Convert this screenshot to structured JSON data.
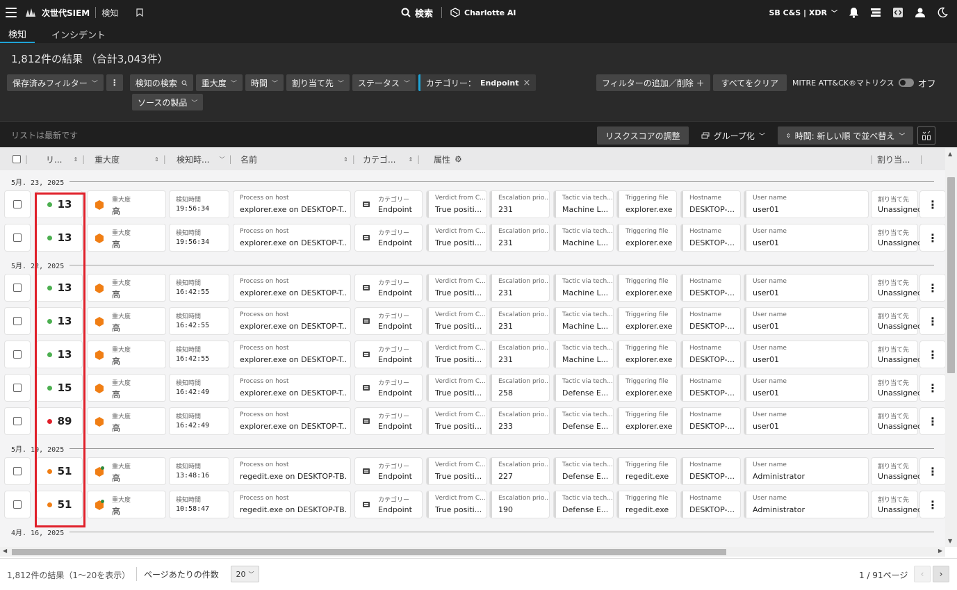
{
  "app": {
    "title": "次世代SIEM",
    "section": "検知",
    "search_label": "検索",
    "charlotte_label": "Charlotte AI",
    "tenant": "SB C&S | XDR"
  },
  "tabs": [
    {
      "label": "検知",
      "active": true
    },
    {
      "label": "インシデント",
      "active": false
    }
  ],
  "header": {
    "results_title": "1,812件の結果 （合計3,043件）",
    "saved_filters": "保存済みフィルター",
    "kebab": "⋮",
    "filters": [
      {
        "label": "検知の検索"
      },
      {
        "label": "重大度"
      },
      {
        "label": "時間"
      },
      {
        "label": "割り当て先"
      },
      {
        "label": "ステータス"
      }
    ],
    "category_filter_label": "カテゴリー：",
    "category_filter_value": "Endpoint",
    "source_product": "ソースの製品",
    "add_remove_filter": "フィルターの追加／削除 ＋",
    "clear_all": "すべてをクリア",
    "mitre_label": "MITRE ATT&CK®マトリクス",
    "mitre_state": "オフ"
  },
  "subbar": {
    "list_status": "リストは最新です",
    "risk_adjust": "リスクスコアの調整",
    "group_by": "グループ化",
    "sort": "時間: 新しい順 で並べ替え"
  },
  "columns": {
    "risk": "リ...",
    "severity": "重大度",
    "detect_time": "検知時...",
    "name": "名前",
    "category": "カテゴ...",
    "attributes": "属性",
    "assignee": "割り当..."
  },
  "labels": {
    "severity": "重大度",
    "detect_time": "検知時間",
    "process": "Process on host",
    "category": "カテゴリー",
    "verdict": "Verdict from C...",
    "escalation": "Escalation prio...",
    "tactic": "Tactic via tech...",
    "triggering": "Triggering file",
    "hostname": "Hostname",
    "username": "User name",
    "assignee": "割り当て先"
  },
  "dates": [
    "5月. 23, 2025",
    "5月. 22, 2025",
    "5月. 19, 2025",
    "4月. 16, 2025"
  ],
  "rows": [
    {
      "risk": "13",
      "risk_color": "#4caf50",
      "severity": "高",
      "time": "19:56:34",
      "name": "explorer.exe on DESKTOP-T...",
      "category": "Endpoint",
      "verdict": "True positi...",
      "escalation": "231",
      "tactic": "Machine L...",
      "triggering": "explorer.exe",
      "hostname": "DESKTOP-...",
      "username": "user01",
      "assignee": "Unassigned",
      "badge": false
    },
    {
      "risk": "13",
      "risk_color": "#4caf50",
      "severity": "高",
      "time": "19:56:34",
      "name": "explorer.exe on DESKTOP-T...",
      "category": "Endpoint",
      "verdict": "True positi...",
      "escalation": "231",
      "tactic": "Machine L...",
      "triggering": "explorer.exe",
      "hostname": "DESKTOP-...",
      "username": "user01",
      "assignee": "Unassigned",
      "badge": false
    },
    {
      "risk": "13",
      "risk_color": "#4caf50",
      "severity": "高",
      "time": "16:42:55",
      "name": "explorer.exe on DESKTOP-T...",
      "category": "Endpoint",
      "verdict": "True positi...",
      "escalation": "231",
      "tactic": "Machine L...",
      "triggering": "explorer.exe",
      "hostname": "DESKTOP-...",
      "username": "user01",
      "assignee": "Unassigned",
      "badge": false
    },
    {
      "risk": "13",
      "risk_color": "#4caf50",
      "severity": "高",
      "time": "16:42:55",
      "name": "explorer.exe on DESKTOP-T...",
      "category": "Endpoint",
      "verdict": "True positi...",
      "escalation": "231",
      "tactic": "Machine L...",
      "triggering": "explorer.exe",
      "hostname": "DESKTOP-...",
      "username": "user01",
      "assignee": "Unassigned",
      "badge": false
    },
    {
      "risk": "13",
      "risk_color": "#4caf50",
      "severity": "高",
      "time": "16:42:55",
      "name": "explorer.exe on DESKTOP-T...",
      "category": "Endpoint",
      "verdict": "True positi...",
      "escalation": "231",
      "tactic": "Machine L...",
      "triggering": "explorer.exe",
      "hostname": "DESKTOP-...",
      "username": "user01",
      "assignee": "Unassigned",
      "badge": false
    },
    {
      "risk": "15",
      "risk_color": "#4caf50",
      "severity": "高",
      "time": "16:42:49",
      "name": "explorer.exe on DESKTOP-T...",
      "category": "Endpoint",
      "verdict": "True positi...",
      "escalation": "258",
      "tactic": "Defense E...",
      "triggering": "explorer.exe",
      "hostname": "DESKTOP-...",
      "username": "user01",
      "assignee": "Unassigned",
      "badge": false
    },
    {
      "risk": "89",
      "risk_color": "#e0202a",
      "severity": "高",
      "time": "16:42:49",
      "name": "explorer.exe on DESKTOP-T...",
      "category": "Endpoint",
      "verdict": "True positi...",
      "escalation": "233",
      "tactic": "Defense E...",
      "triggering": "explorer.exe",
      "hostname": "DESKTOP-...",
      "username": "user01",
      "assignee": "Unassigned",
      "badge": false
    },
    {
      "risk": "51",
      "risk_color": "#f07e14",
      "severity": "高",
      "time": "13:48:16",
      "name": "regedit.exe on DESKTOP-TB...",
      "category": "Endpoint",
      "verdict": "True positi...",
      "escalation": "227",
      "tactic": "Defense E...",
      "triggering": "regedit.exe",
      "hostname": "DESKTOP-...",
      "username": "Administrator",
      "assignee": "Unassigned",
      "badge": true
    },
    {
      "risk": "51",
      "risk_color": "#f07e14",
      "severity": "高",
      "time": "10:58:47",
      "name": "regedit.exe on DESKTOP-TB...",
      "category": "Endpoint",
      "verdict": "True positi...",
      "escalation": "190",
      "tactic": "Defense E...",
      "triggering": "regedit.exe",
      "hostname": "DESKTOP-...",
      "username": "Administrator",
      "assignee": "Unassigned",
      "badge": true
    }
  ],
  "footer": {
    "count": "1,812件の結果（1～20を表示）",
    "per_page_label": "ページあたりの件数",
    "per_page": "20",
    "page_info": "1 / 91ページ"
  },
  "colors": {
    "accent": "#1fa3d6",
    "severity_high": "#f07e14",
    "highlight": "#e0202a"
  }
}
